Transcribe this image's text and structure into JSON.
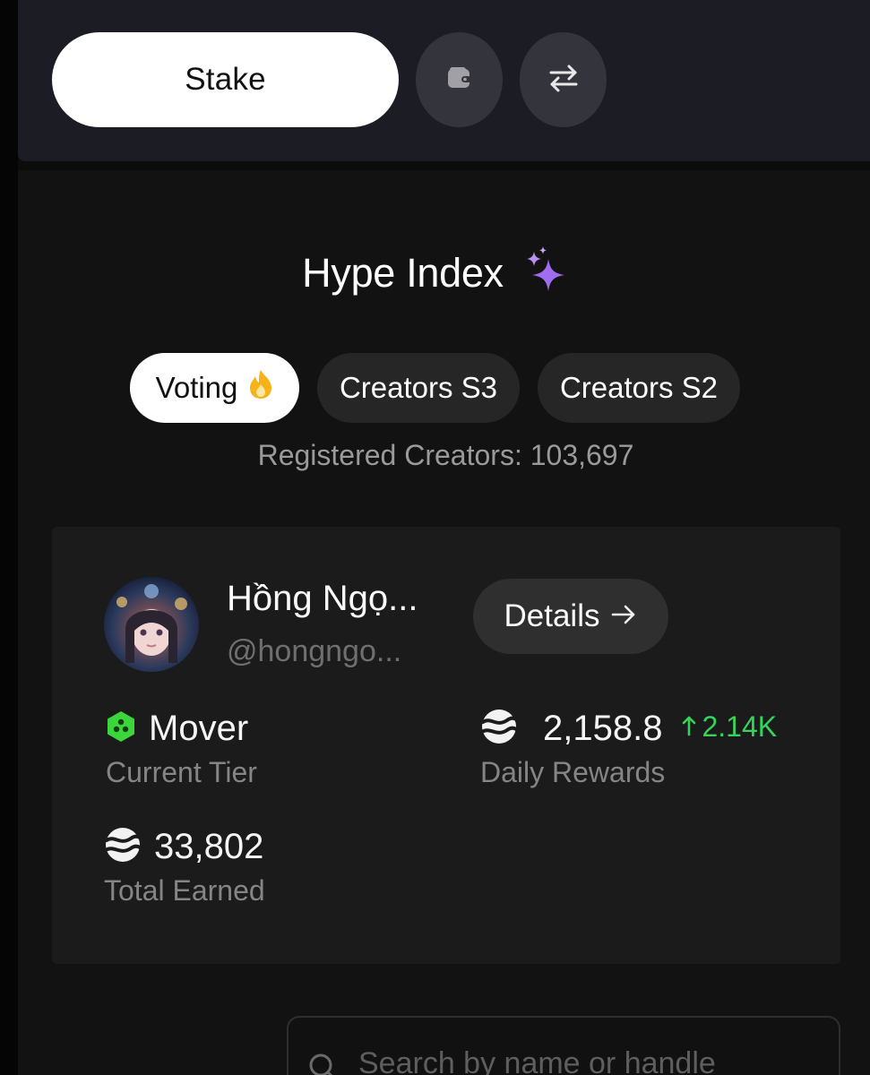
{
  "toolbar": {
    "stake_label": "Stake",
    "wallet_icon": "wallet-icon",
    "swap_icon": "swap-arrows-icon"
  },
  "header": {
    "title": "Hype Index",
    "title_icon": "sparkles-icon",
    "accent_color": "#a06cf0"
  },
  "tabs": [
    {
      "label": "Voting",
      "icon": "flame-icon",
      "active": true
    },
    {
      "label": "Creators S3",
      "active": false
    },
    {
      "label": "Creators S2",
      "active": false
    }
  ],
  "registered_text": "Registered Creators: 103,697",
  "creator": {
    "name": "Hồng Ngọ...",
    "handle": "@hongngo...",
    "details_label": "Details",
    "tier": {
      "value": "Mover",
      "label": "Current Tier",
      "icon": "tier-hexagon-icon",
      "color": "#3bd63b"
    },
    "daily_rewards": {
      "value": "2,158.8",
      "label": "Daily Rewards",
      "delta": "2.14K",
      "delta_color": "#35d45a"
    },
    "total_earned": {
      "value": "33,802",
      "label": "Total Earned"
    }
  },
  "search": {
    "placeholder": "Search by name or handle"
  }
}
